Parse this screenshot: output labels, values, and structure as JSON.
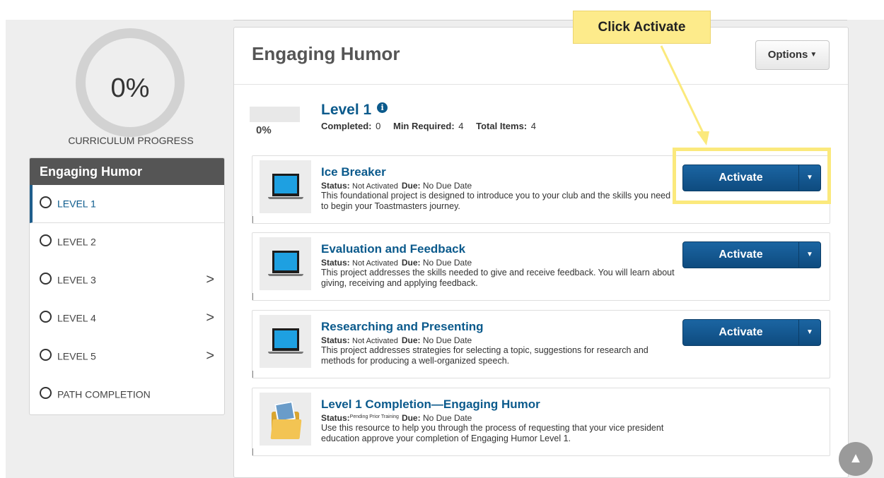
{
  "progress": {
    "percent_text": "0%",
    "label": "CURRICULUM PROGRESS"
  },
  "sidebar": {
    "title": "Engaging Humor",
    "items": [
      {
        "label": "LEVEL 1"
      },
      {
        "label": "LEVEL 2"
      },
      {
        "label": "LEVEL 3",
        "chevron": ">"
      },
      {
        "label": "LEVEL 4",
        "chevron": ">"
      },
      {
        "label": "LEVEL 5",
        "chevron": ">"
      },
      {
        "label": "PATH COMPLETION"
      }
    ]
  },
  "main": {
    "title": "Engaging Humor",
    "options_label": "Options",
    "level": {
      "title": "Level 1",
      "info_icon": "i",
      "percent_text": "0%",
      "progress_fraction": 0,
      "completed_label": "Completed:",
      "completed_value": "0",
      "min_required_label": "Min Required:",
      "min_required_value": "4",
      "total_items_label": "Total Items:",
      "total_items_value": "4"
    },
    "cards": [
      {
        "title": "Ice Breaker",
        "status_label": "Status:",
        "status_value": "Not Activated",
        "due_label": "Due:",
        "due_value": "No Due Date",
        "description": "This foundational project is designed to introduce you to your club and the skills you need to begin your Toastmasters journey.",
        "button_label": "Activate",
        "icon": "laptop-icon"
      },
      {
        "title": "Evaluation and Feedback",
        "status_label": "Status:",
        "status_value": "Not Activated",
        "due_label": "Due:",
        "due_value": "No Due Date",
        "description": "This project addresses the skills needed to give and receive feedback. You will learn about giving, receiving and applying feedback.",
        "button_label": "Activate",
        "icon": "laptop-icon"
      },
      {
        "title": "Researching and Presenting",
        "status_label": "Status:",
        "status_value": "Not Activated",
        "due_label": "Due:",
        "due_value": "No Due Date",
        "description": "This project addresses strategies for selecting a topic, suggestions for research and methods for producing a well-organized speech.",
        "button_label": "Activate",
        "icon": "laptop-icon"
      },
      {
        "title": "Level 1 Completion—Engaging Humor",
        "status_label": "Status:",
        "status_value": "Pending Prior Training",
        "due_label": "Due:",
        "due_value": "No Due Date",
        "description": "Use this resource to help you through the process of requesting that your vice president education approve your completion of Engaging Humor Level 1.",
        "icon": "folder-icon"
      }
    ]
  },
  "callout": {
    "text": "Click Activate",
    "color": "#fdeb8b"
  },
  "colors": {
    "accent": "#0b5a8c",
    "button": "#14588f",
    "highlight": "#fbe97c"
  }
}
